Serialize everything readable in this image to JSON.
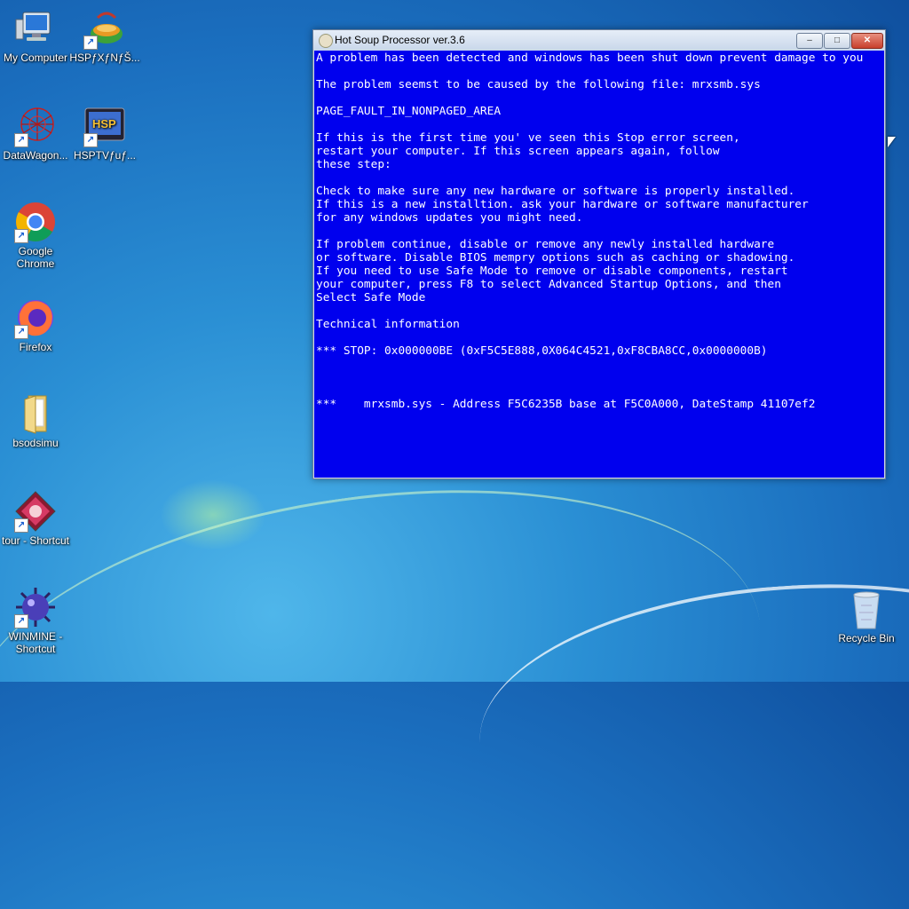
{
  "desktop": {
    "icons": [
      {
        "label": "My Computer",
        "icon": "computer-icon"
      },
      {
        "label": "HSPƒXƒNƒŠ...",
        "icon": "hsp-script-icon"
      },
      {
        "label": "DataWagon...",
        "icon": "datawagon-icon"
      },
      {
        "label": "HSPTVƒuƒ...",
        "icon": "hsptv-icon"
      },
      {
        "label": "Google Chrome",
        "icon": "chrome-icon"
      },
      {
        "label": "Firefox",
        "icon": "firefox-icon"
      },
      {
        "label": "bsodsimu",
        "icon": "folder-icon"
      },
      {
        "label": "tour - Shortcut",
        "icon": "tour-icon"
      },
      {
        "label": "WINMINE - Shortcut",
        "icon": "minesweeper-icon"
      },
      {
        "label": "Recycle Bin",
        "icon": "recycle-bin-icon"
      }
    ]
  },
  "window": {
    "title": "Hot Soup Processor ver.3.6",
    "minimize": "–",
    "maximize": "□",
    "close": "✕",
    "lines": [
      "A problem has been detected and windows has been shut down prevent damage to you",
      "",
      "The problem seemst to be caused by the following file: mrxsmb.sys",
      "",
      "PAGE_FAULT_IN_NONPAGED_AREA",
      "",
      "If this is the first time you' ve seen this Stop error screen,",
      "restart your computer. If this screen appears again, follow",
      "these step:",
      "",
      "Check to make sure any new hardware or software is properly installed.",
      "If this is a new installtion. ask your hardware or software manufacturer",
      "for any windows updates you might need.",
      "",
      "If problem continue, disable or remove any newly installed hardware",
      "or software. Disable BIOS mempry options such as caching or shadowing.",
      "If you need to use Safe Mode to remove or disable components, restart",
      "your computer, press F8 to select Advanced Startup Options, and then",
      "Select Safe Mode",
      "",
      "Technical information",
      "",
      "*** STOP: 0x000000BE (0xF5C5E888,0X064C4521,0xF8CBA8CC,0x0000000B)",
      "",
      "",
      "",
      "***    mrxsmb.sys - Address F5C6235B base at F5C0A000, DateStamp 41107ef2"
    ]
  }
}
